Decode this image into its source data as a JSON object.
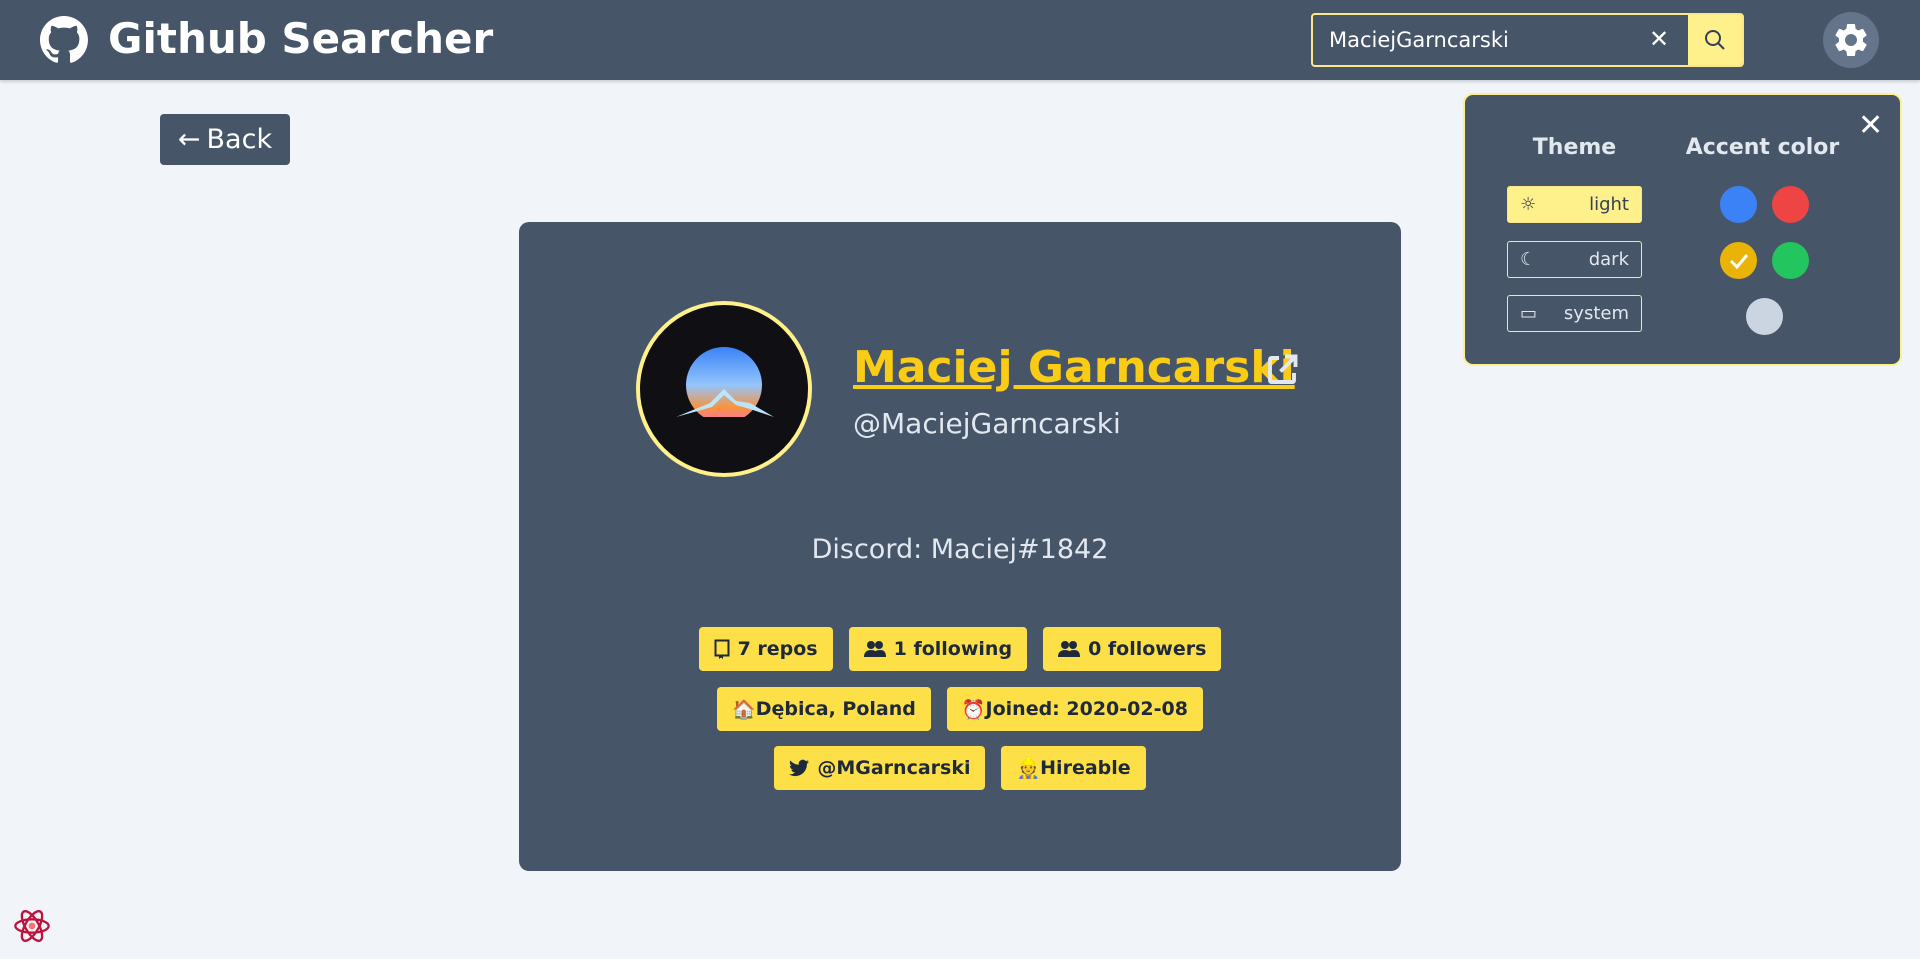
{
  "header": {
    "title": "Github Searcher",
    "search_value": "MaciejGarncarski",
    "clear_icon": "✕"
  },
  "back": {
    "label": "Back",
    "arrow": "←"
  },
  "profile": {
    "name": "Maciej Garncarski",
    "login": "@MaciejGarncarski",
    "bio": "Discord: Maciej#1842",
    "badges_row1": [
      {
        "icon": "book-icon",
        "label": "7 repos"
      },
      {
        "icon": "users-icon",
        "label": "1 following"
      },
      {
        "icon": "users-icon",
        "label": "0 followers"
      }
    ],
    "badges_row2": [
      {
        "icon": "🏠",
        "label": "Dębica, Poland"
      },
      {
        "icon": "⏰",
        "label": "Joined: 2020-02-08"
      }
    ],
    "badges_row3": [
      {
        "icon": "twitter-icon",
        "label": "@MGarncarski"
      },
      {
        "icon": "👷",
        "label": "Hireable"
      }
    ]
  },
  "settings": {
    "theme_heading": "Theme",
    "accent_heading": "Accent color",
    "themes": [
      {
        "label": "light",
        "active": true
      },
      {
        "label": "dark",
        "active": false
      },
      {
        "label": "system",
        "active": false
      }
    ],
    "accent_colors": [
      {
        "color": "#3b82f6"
      },
      {
        "color": "#ef4444"
      },
      {
        "color": "#eab308",
        "selected": true
      },
      {
        "color": "#22c55e"
      },
      {
        "color": "#cbd5e1"
      }
    ]
  },
  "colors": {
    "header": "#475569",
    "accent": "#facc15",
    "background": "#f1f5f9"
  }
}
